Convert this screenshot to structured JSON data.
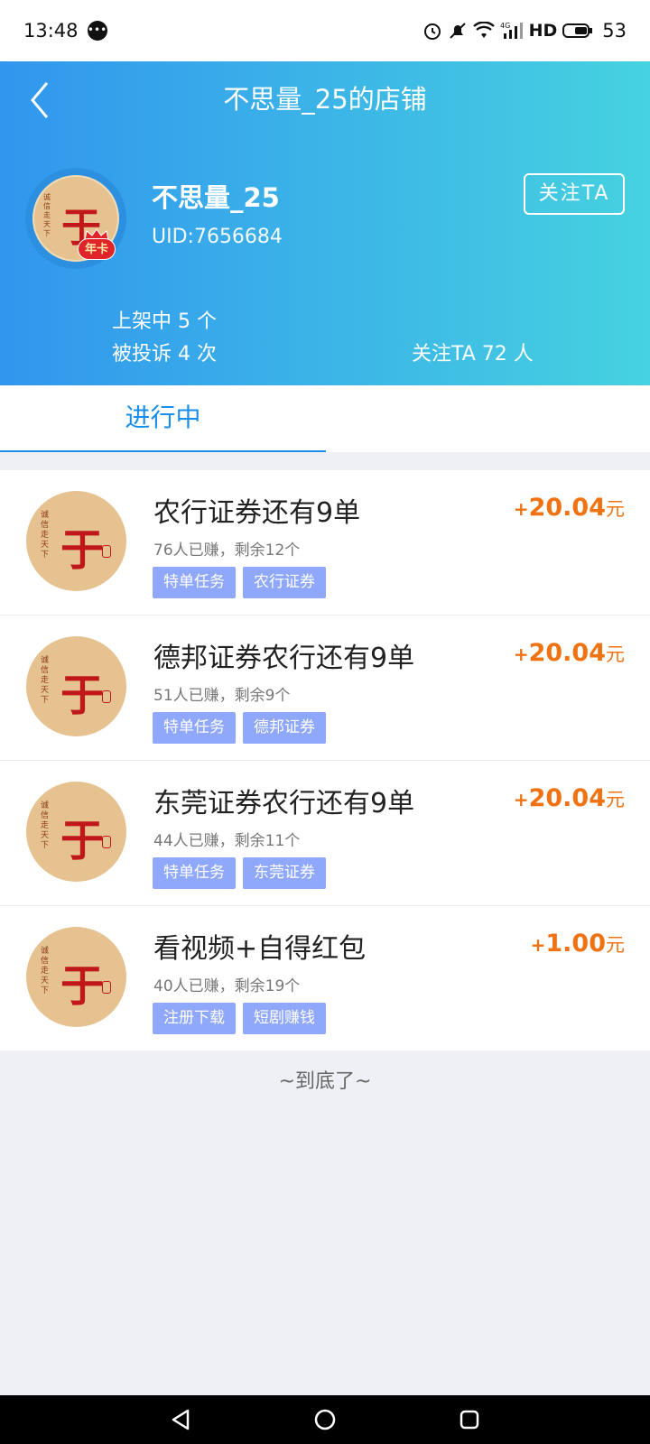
{
  "status_bar": {
    "time": "13:48",
    "msg_icon": "chat-bubble-icon",
    "network": "HD",
    "battery": "53"
  },
  "header": {
    "title": "不思量_25的店铺",
    "shop_name": "不思量_25",
    "uid": "UID:7656684",
    "follow_label": "关注TA",
    "avatar_glyph": "于",
    "avatar_side_text": "诚信走天下",
    "vip_badge": "年卡",
    "stats": {
      "listing": "上架中 5 个",
      "complaints": "被投诉 4 次",
      "followers": "关注TA 72 人"
    }
  },
  "tabs": [
    {
      "label": "进行中",
      "active": true
    }
  ],
  "tasks": [
    {
      "title": "农行证券还有9单",
      "meta": "76人已赚，剩余12个",
      "tags": [
        "特单任务",
        "农行证券"
      ],
      "reward_plus": "+",
      "reward_amount": "20.04",
      "reward_unit": "元"
    },
    {
      "title": "德邦证券农行还有9单",
      "meta": "51人已赚，剩余9个",
      "tags": [
        "特单任务",
        "德邦证券"
      ],
      "reward_plus": "+",
      "reward_amount": "20.04",
      "reward_unit": "元"
    },
    {
      "title": "东莞证券农行还有9单",
      "meta": "44人已赚，剩余11个",
      "tags": [
        "特单任务",
        "东莞证券"
      ],
      "reward_plus": "+",
      "reward_amount": "20.04",
      "reward_unit": "元"
    },
    {
      "title": "看视频+自得红包",
      "meta": "40人已赚，剩余19个",
      "tags": [
        "注册下载",
        "短剧赚钱"
      ],
      "reward_plus": "+",
      "reward_amount": "1.00",
      "reward_unit": "元"
    }
  ],
  "end_text": "~到底了~",
  "colors": {
    "header_start": "#3196ee",
    "header_end": "#46d2e0",
    "accent_blue": "#1a8ee8",
    "reward_orange": "#f07313",
    "tag_bg": "#8fa8fb"
  },
  "nav": {
    "back": "back-triangle-icon",
    "home": "home-circle-icon",
    "recents": "recents-square-icon"
  }
}
